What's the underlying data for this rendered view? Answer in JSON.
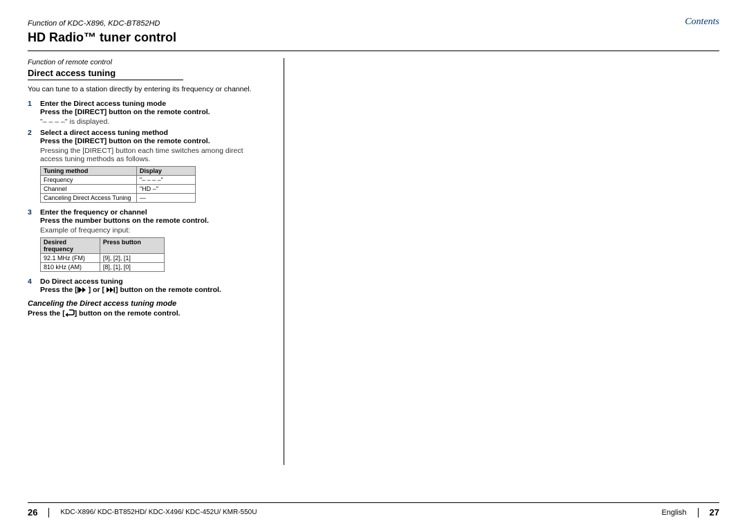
{
  "header": {
    "func_of": "Function of KDC-X896, KDC-BT852HD",
    "contents_link": "Contents",
    "title": "HD Radio™ tuner control"
  },
  "section": {
    "sub_func": "Function of remote control",
    "heading": "Direct access tuning",
    "intro": "You can tune to a station directly by entering its frequency or channel."
  },
  "steps": {
    "s1_num": "1",
    "s1_b1": "Enter the Direct access tuning mode",
    "s1_b2": "Press the [DIRECT] button on the remote control.",
    "s1_extra": "\"– – – –\" is displayed.",
    "s2_num": "2",
    "s2_b1": "Select a direct access tuning method",
    "s2_b2": "Press the [DIRECT] button on the remote control.",
    "s2_extra": "Pressing the [DIRECT] button each time switches among direct access tuning methods as follows.",
    "s3_num": "3",
    "s3_b1": "Enter the frequency or channel",
    "s3_b2": "Press the number buttons on the remote control.",
    "s3_extra": "Example of frequency input:",
    "s4_num": "4",
    "s4_b1": "Do Direct access tuning",
    "s4_b2a": "Press the [",
    "s4_b2b": "] or [",
    "s4_b2c": "] button on the remote control."
  },
  "table1": {
    "h1": "Tuning method",
    "h2": "Display",
    "r1c1": "Frequency",
    "r1c2": "\"– – – –\"",
    "r2c1": "Channel",
    "r2c2": "\"HD –\"",
    "r3c1": "Canceling Direct Access Tuning",
    "r3c2": "—"
  },
  "table2": {
    "h1": "Desired frequency",
    "h2": "Press button",
    "r1c1": "92.1 MHz (FM)",
    "r1c2": "[9], [2], [1]",
    "r2c1": "810 kHz (AM)",
    "r2c2": "[8], [1], [0]"
  },
  "cancel": {
    "heading": "Canceling the Direct access tuning mode",
    "body_a": "Press the [",
    "body_b": "] button on the remote control."
  },
  "footer": {
    "page_left": "26",
    "models": "KDC-X896/ KDC-BT852HD/ KDC-X496/ KDC-452U/ KMR-550U",
    "language": "English",
    "page_right": "27"
  }
}
